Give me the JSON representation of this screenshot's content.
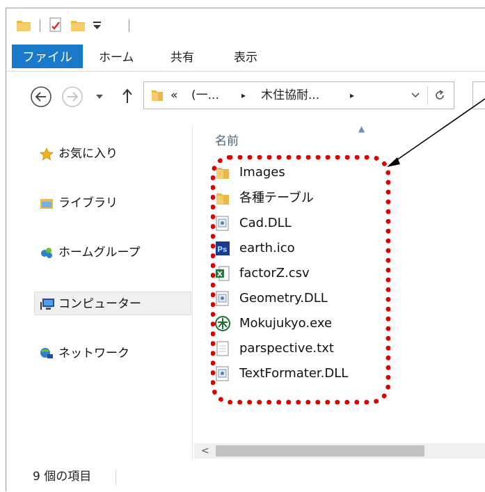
{
  "ribbon": {
    "tabs": [
      "ファイル",
      "ホーム",
      "共有",
      "表示"
    ]
  },
  "address": {
    "prefix": "«",
    "crumbs": [
      "(一...",
      "木住協耐..."
    ],
    "separator": "▸"
  },
  "nav_pane": {
    "items": [
      {
        "label": "お気に入り",
        "icon": "star-icon"
      },
      {
        "label": "ライブラリ",
        "icon": "library-icon"
      },
      {
        "label": "ホームグループ",
        "icon": "homegroup-icon"
      },
      {
        "label": "コンピューター",
        "icon": "computer-icon",
        "selected": true
      },
      {
        "label": "ネットワーク",
        "icon": "network-icon"
      }
    ]
  },
  "content": {
    "column_header": "名前",
    "files": [
      {
        "name": "Images",
        "type": "folder"
      },
      {
        "name": "各種テーブル",
        "type": "folder"
      },
      {
        "name": "Cad.DLL",
        "type": "dll"
      },
      {
        "name": "earth.ico",
        "type": "ps"
      },
      {
        "name": "factorZ.csv",
        "type": "csv"
      },
      {
        "name": "Geometry.DLL",
        "type": "dll"
      },
      {
        "name": "Mokujukyo.exe",
        "type": "exe"
      },
      {
        "name": "parspective.txt",
        "type": "txt"
      },
      {
        "name": "TextFormater.DLL",
        "type": "dll"
      }
    ]
  },
  "status": {
    "item_count": "9 個の項目"
  },
  "colors": {
    "file_tab": "#1979ca",
    "highlight": "#e00000",
    "folder": "#e8b84a"
  }
}
